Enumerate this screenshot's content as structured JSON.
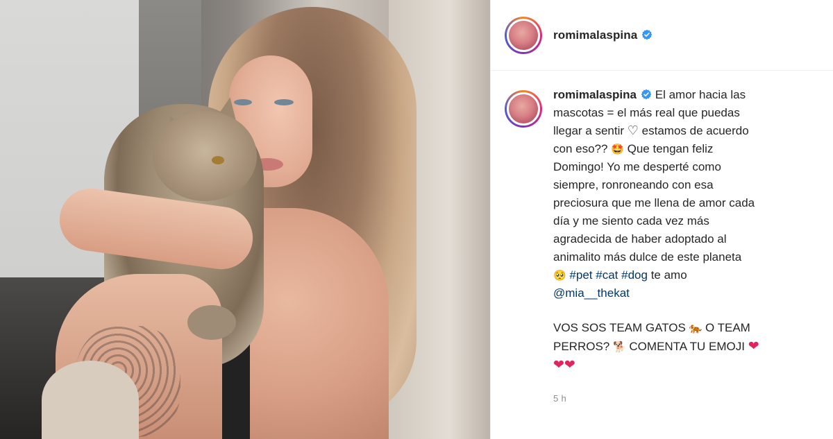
{
  "photo": {
    "description_icon": "photo-of-woman-holding-cat"
  },
  "post": {
    "username": "romimalaspina",
    "verified_icon": "verified-badge-icon",
    "caption_lines": [
      "El amor hacia las",
      "mascotas = el más real que puedas",
      "llegar a sentir",
      "estamos de acuerdo",
      "con eso??",
      "Que tengan feliz",
      "Domingo! Yo me desperté como",
      "siempre, ronroneando con esa",
      "preciosura que me llena de amor cada",
      "día y me siento cada vez más",
      "agradecida de haber adoptado al",
      "animalito más dulce de este planeta"
    ],
    "hashtags": [
      "#pet",
      "#cat",
      "#dog"
    ],
    "after_tags": "te amo",
    "mention": "@mia__thekat",
    "second_paragraph": {
      "line1": "VOS SOS TEAM GATOS",
      "or": "O TEAM",
      "line2_start": "PERROS?",
      "line2_end": "COMENTA TU EMOJI"
    },
    "timestamp": "5 h",
    "emojis": {
      "heart_outline": "♡",
      "star_eyes": "🤩",
      "pleading": "🥺",
      "tiger": "🐅",
      "dog": "🐕",
      "red_heart": "❤"
    },
    "colors": {
      "link": "#00376b",
      "text": "#262626",
      "muted": "#8e8e8e",
      "verified": "#3897f0"
    }
  }
}
